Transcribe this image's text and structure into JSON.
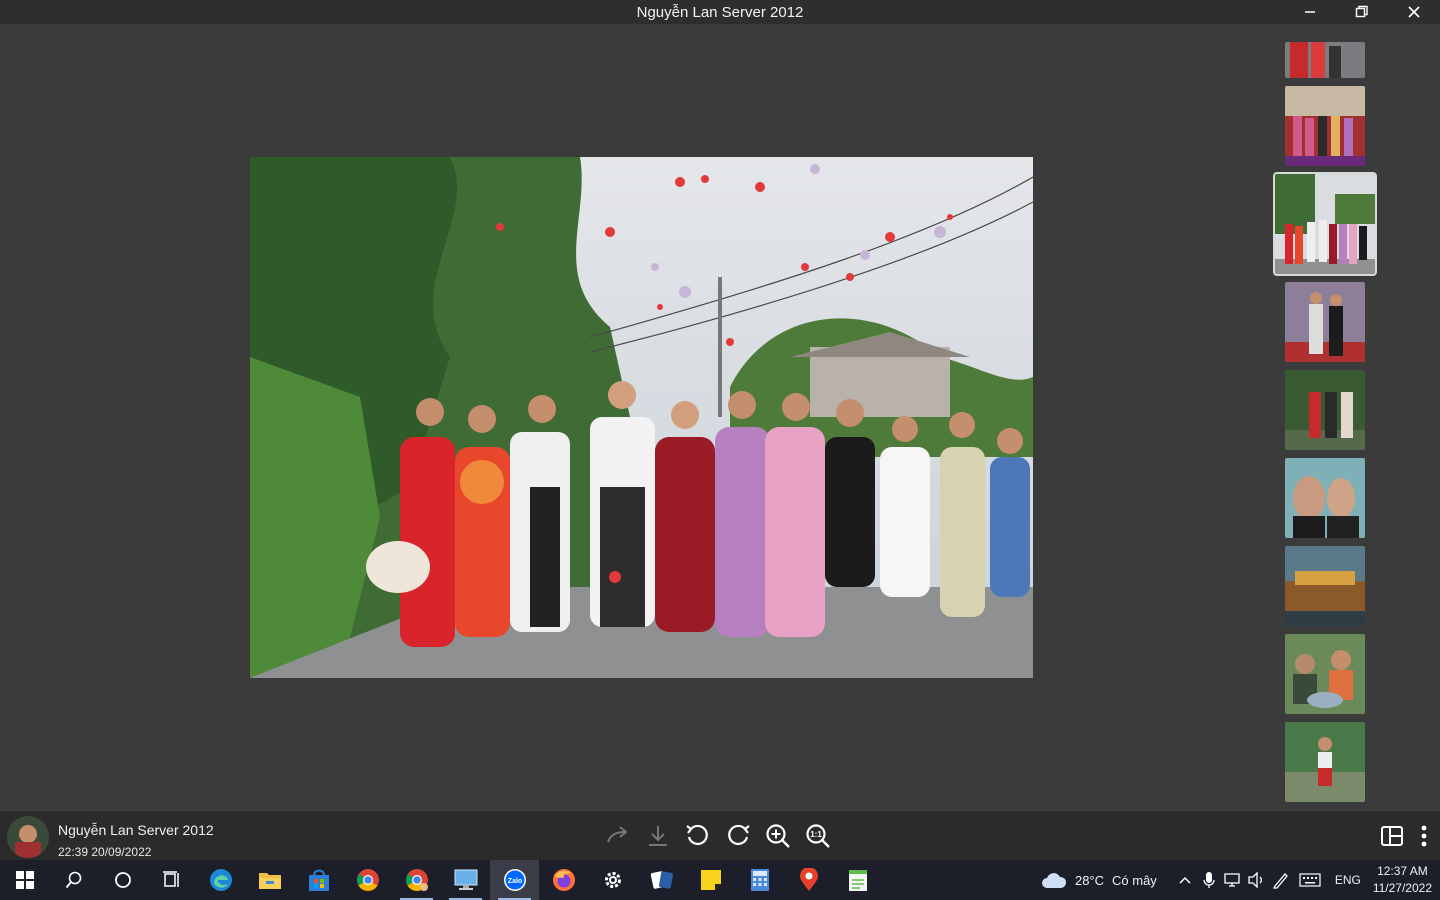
{
  "window": {
    "title": "Nguyễn Lan Server 2012",
    "controls": [
      "minimize-icon",
      "restore-icon",
      "close-icon"
    ]
  },
  "viewer": {
    "main_photo": "wedding-family-group-photo",
    "thumbnails": [
      {
        "name": "thumb-red-dresses-partial",
        "active": false
      },
      {
        "name": "thumb-family-stage",
        "active": false
      },
      {
        "name": "thumb-wedding-group-street",
        "active": true
      },
      {
        "name": "thumb-couple-portrait",
        "active": false
      },
      {
        "name": "thumb-couple-outdoor",
        "active": false
      },
      {
        "name": "thumb-selfie-couple",
        "active": false
      },
      {
        "name": "thumb-altar-table",
        "active": false
      },
      {
        "name": "thumb-child-cake",
        "active": false
      },
      {
        "name": "thumb-child-standing",
        "active": false
      }
    ]
  },
  "toolbar": {
    "sender_name": "Nguyễn Lan Server 2012",
    "sent_time": "22:39 20/09/2022",
    "tools": [
      "share-icon",
      "download-icon",
      "rotate-left-icon",
      "rotate-right-icon",
      "zoom-in-icon",
      "actual-size-icon"
    ],
    "actual_size_label": "1:1"
  },
  "taskbar": {
    "apps": [
      "windows-start-icon",
      "search-icon",
      "cortana-icon",
      "task-view-icon",
      "edge-icon",
      "file-explorer-icon",
      "store-icon",
      "chrome-icon",
      "chrome-profile-icon",
      "remote-desktop-icon",
      "zalo-icon",
      "firefox-icon",
      "settings-icon",
      "solitaire-icon",
      "sticky-notes-icon",
      "calculator-icon",
      "maps-icon",
      "notepad-icon"
    ],
    "zalo_label": "Zalo",
    "weather_temp": "28°C",
    "weather_desc": "Có mây",
    "language": "ENG",
    "time": "12:37 AM",
    "date": "11/27/2022"
  },
  "colors": {
    "viewer_bg": "#3b3b3b",
    "toolbar_bg": "#2b2b2b",
    "taskbar_bg": "#1c1f2a",
    "disabled_icon": "#777777"
  }
}
